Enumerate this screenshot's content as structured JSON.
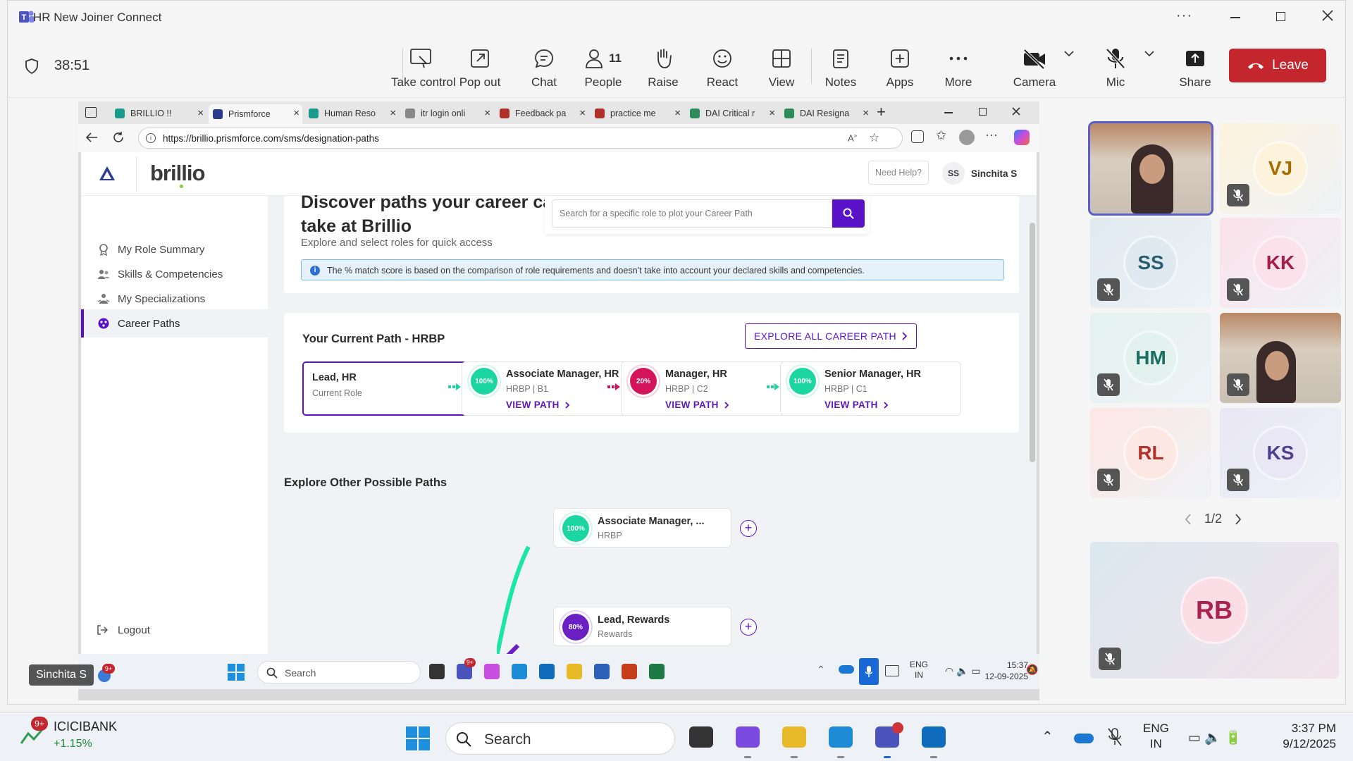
{
  "teams": {
    "window_title": "HR New Joiner Connect",
    "timer": "38:51",
    "people_count": "11",
    "toolbar": [
      {
        "label": "Take control",
        "icon": "take-control-icon"
      },
      {
        "label": "Pop out",
        "icon": "pop-out-icon"
      },
      {
        "label": "Chat",
        "icon": "chat-icon"
      },
      {
        "label": "People",
        "icon": "people-icon"
      },
      {
        "label": "Raise",
        "icon": "raise-hand-icon"
      },
      {
        "label": "React",
        "icon": "react-icon"
      },
      {
        "label": "View",
        "icon": "view-icon"
      },
      {
        "label": "Notes",
        "icon": "notes-icon"
      },
      {
        "label": "Apps",
        "icon": "apps-icon"
      },
      {
        "label": "More",
        "icon": "more-icon"
      },
      {
        "label": "Camera",
        "icon": "camera-off-icon"
      },
      {
        "label": "Mic",
        "icon": "mic-off-icon"
      },
      {
        "label": "Share",
        "icon": "share-icon"
      }
    ],
    "leave_label": "Leave",
    "leave_color": "#c4262e",
    "presenter_name": "Sinchita S",
    "presenter_badge": "9+",
    "participants": [
      {
        "initials": "VJ",
        "bg": "#fdf3dd",
        "fg": "#a66c00"
      },
      {
        "initials": "SS",
        "bg": "#dfeaf0",
        "fg": "#2d5d6f"
      },
      {
        "initials": "KK",
        "bg": "#fbe2ea",
        "fg": "#a61d4c"
      },
      {
        "initials": "HM",
        "bg": "#e3f2ef",
        "fg": "#1b6e62"
      },
      {
        "initials": "RL",
        "bg": "#fde7e3",
        "fg": "#b0322a"
      },
      {
        "initials": "KS",
        "bg": "#e9e6f5",
        "fg": "#4f3f8f"
      },
      {
        "initials": "RB",
        "bg": "#fbdde6",
        "fg": "#a8244f"
      }
    ],
    "gallery_page": "1/2"
  },
  "browser": {
    "tabs": [
      "BRILLIO !!",
      "Prismforce",
      "Human Reso",
      "itr login onli",
      "Feedback pa",
      "practice me",
      "DAI Critical r",
      "DAI Resigna"
    ],
    "active_tab": 1,
    "url": "https://brillio.prismforce.com/sms/designation-paths"
  },
  "app": {
    "logo": "brillio",
    "need_help": "Need Help?",
    "user_initials": "SS",
    "user_name": "Sinchita S",
    "sidebar": [
      {
        "label": "My Role Summary",
        "icon": "role-summary-icon"
      },
      {
        "label": "Skills & Competencies",
        "icon": "skills-icon"
      },
      {
        "label": "My Specializations",
        "icon": "specializations-icon"
      },
      {
        "label": "Career Paths",
        "icon": "career-paths-icon",
        "active": true
      }
    ],
    "logout": "Logout",
    "heading_line1": "Discover paths your career can",
    "heading_line2": "take at Brillio",
    "subheading": "Explore and select roles for quick access",
    "search_placeholder": "Search for a specific role to plot your Career Path",
    "info_text": "The % match score is based on the comparison of role requirements and doesn’t take into account your declared skills and competencies.",
    "current_path": {
      "title": "Your Current Path - HRBP",
      "explore_button": "EXPLORE ALL CAREER PATH",
      "current": {
        "title": "Lead, HR",
        "subtitle": "Current Role"
      },
      "nodes": [
        {
          "title": "Associate Manager, HR",
          "sub": "HRBP | B1",
          "pct": "100%",
          "color": "#1bd6a0",
          "bookmark": true
        },
        {
          "title": "Manager, HR",
          "sub": "HRBP | C2",
          "pct": "20%",
          "color": "#d4145a",
          "bookmark": false
        },
        {
          "title": "Senior Manager, HR",
          "sub": "HRBP | C1",
          "pct": "100%",
          "color": "#1bd6a0",
          "bookmark": false
        }
      ],
      "view_path": "VIEW PATH"
    },
    "other_paths": {
      "title": "Explore Other Possible Paths",
      "nodes": [
        {
          "title": "Associate Manager, ...",
          "sub": "HRBP",
          "pct": "100%",
          "color": "#1bd6a0"
        },
        {
          "title": "Lead, Rewards",
          "sub": "Rewards",
          "pct": "80%",
          "color": "#6a1fc4"
        }
      ]
    }
  },
  "inner_taskbar": {
    "search": "Search",
    "lang": "ENG",
    "region": "IN",
    "time": "15:37",
    "date": "12-09-2025",
    "teams_badge": "9+"
  },
  "os_taskbar": {
    "stock_name": "ICICIBANK",
    "stock_change": "+1.15%",
    "stock_badge": "9+",
    "search": "Search",
    "lang": "ENG",
    "region": "IN",
    "time": "3:37 PM",
    "date": "9/12/2025"
  }
}
